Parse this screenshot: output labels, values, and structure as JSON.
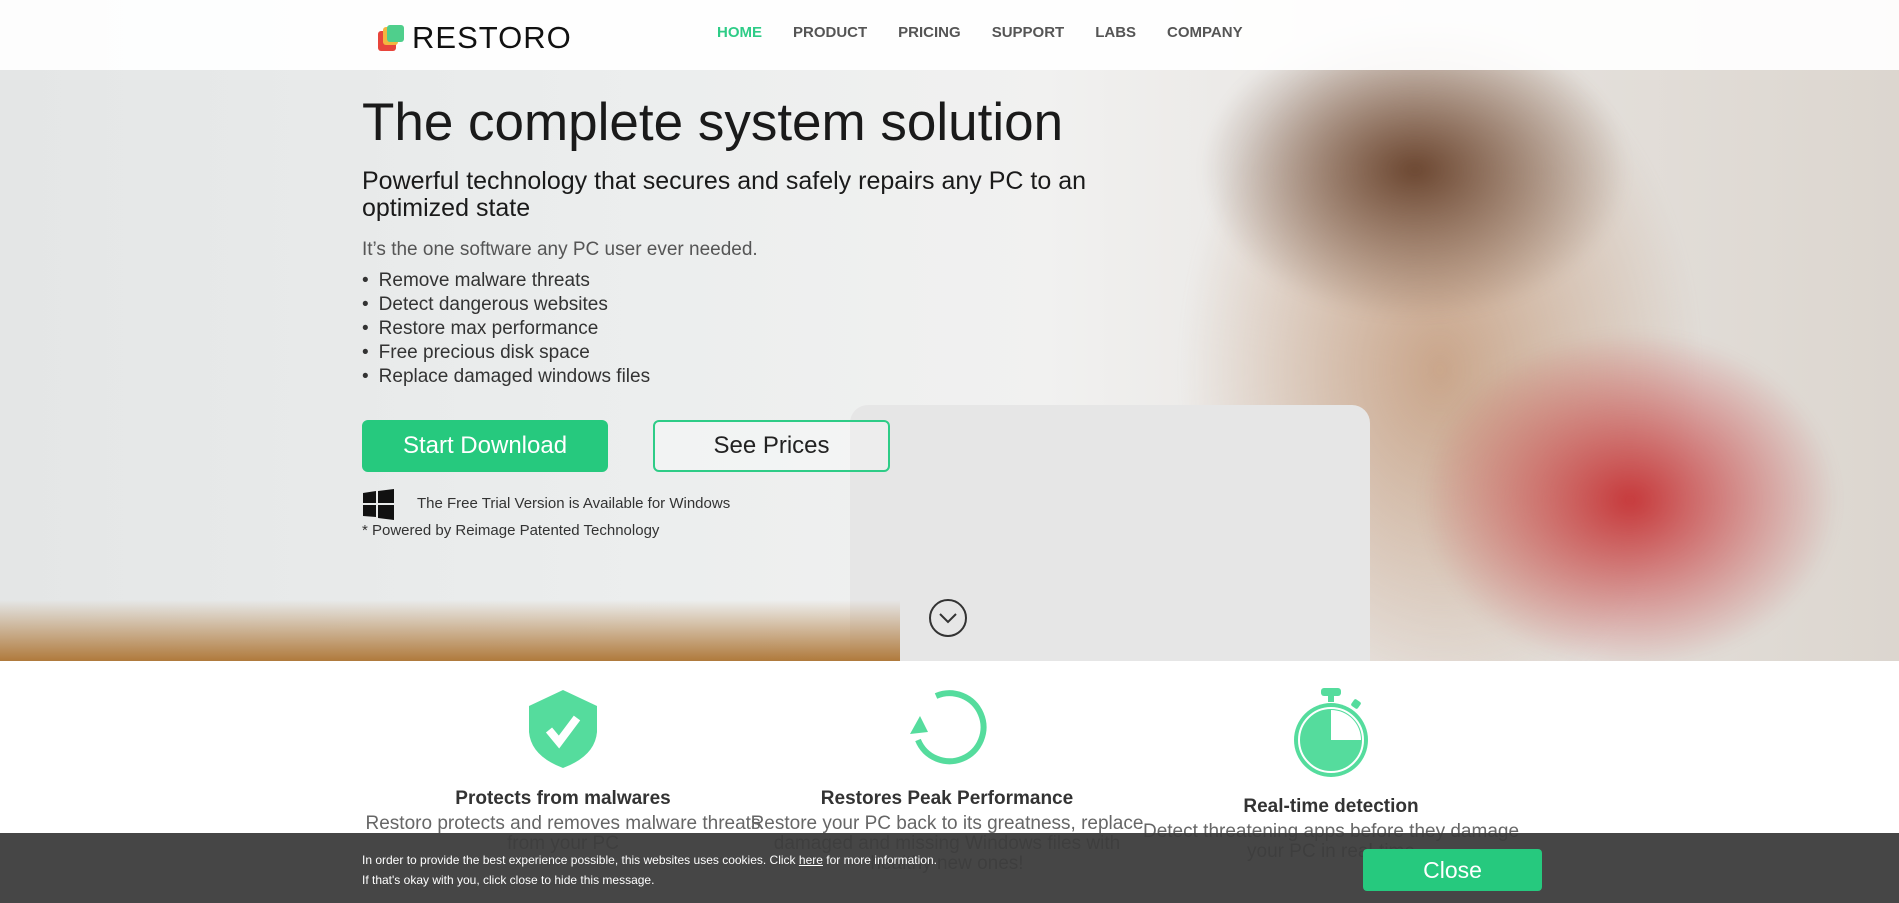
{
  "header": {
    "logo_text": "RESTORO",
    "nav": [
      {
        "label": "HOME",
        "active": true
      },
      {
        "label": "PRODUCT"
      },
      {
        "label": "PRICING"
      },
      {
        "label": "SUPPORT"
      },
      {
        "label": "LABS"
      },
      {
        "label": "COMPANY"
      }
    ]
  },
  "hero": {
    "title": "The complete system solution",
    "subtitle": "Powerful technology that secures and safely repairs any PC to an optimized state",
    "tagline": "It’s the one software any PC user ever needed.",
    "bullets": [
      "Remove malware threats",
      "Detect dangerous websites",
      "Restore max performance",
      "Free precious disk space",
      "Replace damaged windows files"
    ],
    "download_label": "Start Download",
    "prices_label": "See Prices",
    "windows_note": "The Free Trial Version is Available for Windows",
    "powered": "* Powered by Reimage Patented Technology"
  },
  "features": [
    {
      "icon": "shield-check-icon",
      "title": "Protects from malwares",
      "desc": "Restoro protects and removes malware threats from your PC"
    },
    {
      "icon": "restore-arrow-icon",
      "title": "Restores Peak Performance",
      "desc": "Restore your PC back to its greatness, replace damaged and missing Windows files with healthy new ones!"
    },
    {
      "icon": "stopwatch-icon",
      "title": "Real-time detection",
      "desc": "Detect threatening apps before they damage your PC in real-time"
    }
  ],
  "cookie": {
    "text1": "In order to provide the best experience possible, this websites uses cookies. Click",
    "link": "here",
    "text1b": "for more information.",
    "text2": "If that's okay with you, click close to hide this message.",
    "close_label": "Close"
  },
  "colors": {
    "accent": "#26c97e",
    "icon": "#55dc9d",
    "cookie_bg": "#464646"
  }
}
